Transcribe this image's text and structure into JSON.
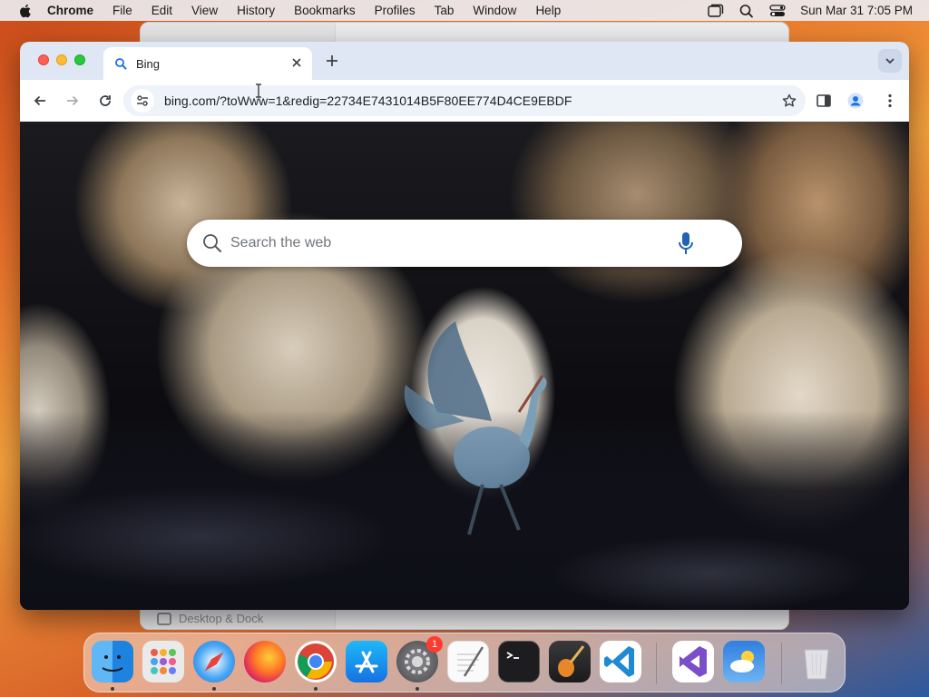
{
  "menubar": {
    "app_name": "Chrome",
    "items": [
      "File",
      "Edit",
      "View",
      "History",
      "Bookmarks",
      "Profiles",
      "Tab",
      "Window",
      "Help"
    ],
    "clock": "Sun Mar 31  7:05 PM",
    "status_icons": [
      "window-switcher-icon",
      "spotlight-search-icon",
      "control-center-icon"
    ]
  },
  "background_window": {
    "sidebar_item": "Desktop & Dock"
  },
  "browser": {
    "tab": {
      "title": "Bing",
      "favicon": "search-icon"
    },
    "url": "bing.com/?toWww=1&redig=22734E7431014B5F80EE774D4CE9EBDF"
  },
  "page": {
    "search_placeholder": "Search the web"
  },
  "dock": {
    "apps": [
      "Finder",
      "Launchpad",
      "Safari",
      "Firefox",
      "Google Chrome",
      "App Store",
      "System Settings",
      "TextEdit",
      "Terminal",
      "GarageBand",
      "Visual Studio Code",
      "Visual Studio",
      "Weather",
      "Trash"
    ],
    "system_settings_badge": "1"
  },
  "colors": {
    "tabstrip": "#dfe7f5",
    "omnibox": "#eef2f9",
    "accent_blue": "#1a73e8"
  }
}
